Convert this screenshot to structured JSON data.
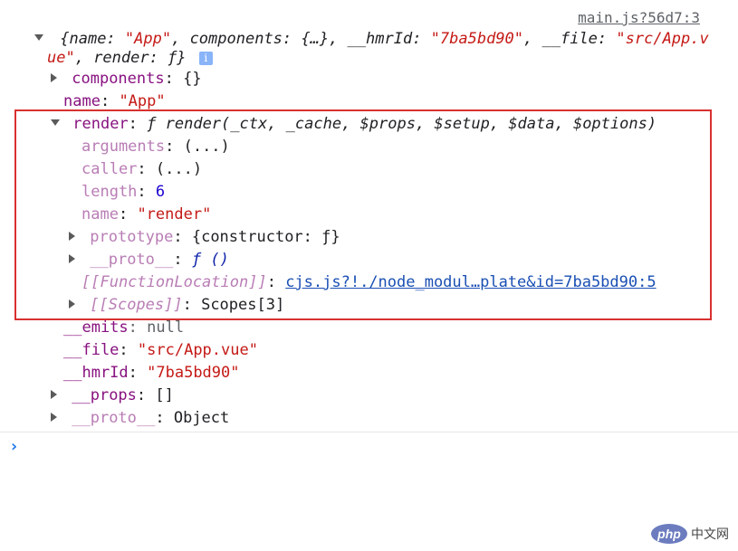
{
  "console": {
    "source_link": "main.js?56d7:3",
    "summary_part1": "{name: ",
    "summary_name": "\"App\"",
    "summary_part2": ", components: {…}, __hmrId: ",
    "summary_hmr": "\"7ba5bd90\"",
    "summary_part3": ", __file: ",
    "summary_file1": "\"src/App.v",
    "summary_file2": "ue\"",
    "summary_part4": ", render: ƒ}",
    "info_badge": "i",
    "rows": {
      "components_key": "components",
      "components_val": ": {}",
      "name_key": "name",
      "name_val": "\"App\"",
      "render_key": "render",
      "render_sig": "ƒ render(_ctx, _cache, $props, $setup, $data, $options)",
      "arguments_key": "arguments",
      "arguments_val": ": (...)",
      "caller_key": "caller",
      "caller_val": ": (...)",
      "length_key": "length",
      "length_val": "6",
      "rname_key": "name",
      "rname_val": "\"render\"",
      "prototype_key": "prototype",
      "prototype_val": ": {constructor: ƒ}",
      "proto_key": "__proto__",
      "proto_val": "ƒ ()",
      "fnloc_key": "[[FunctionLocation]]",
      "fnloc_val": "cjs.js?!./node_modul…plate&id=7ba5bd90:5",
      "scopes_key": "[[Scopes]]",
      "scopes_val": ": Scopes[3]",
      "emits_key": "__emits",
      "emits_val": ": null",
      "file_key": "__file",
      "file_val": "\"src/App.vue\"",
      "hmr_key": "__hmrId",
      "hmr_val": "\"7ba5bd90\"",
      "props_key": "__props",
      "props_val": ": []",
      "oproto_key": "__proto__",
      "oproto_val": ": Object"
    },
    "prompt_symbol": "›"
  },
  "watermark": {
    "logo": "php",
    "text": "中文网"
  },
  "colors": {
    "highlight_box": "#d93030",
    "key": "#881280",
    "string": "#c41a16",
    "number": "#1c00cf"
  }
}
